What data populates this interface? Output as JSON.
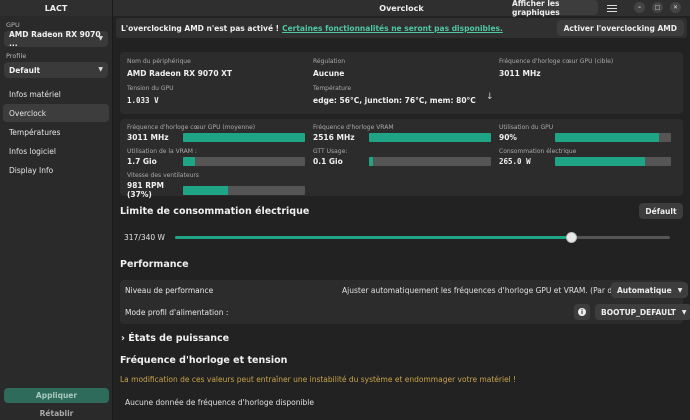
{
  "sidebar": {
    "app_title": "LACT",
    "gpu_label": "GPU",
    "gpu_value": "AMD Radeon RX 9070 ...",
    "profile_label": "Profile",
    "profile_value": "Default",
    "items": [
      {
        "label": "Infos matériel"
      },
      {
        "label": "Overclock"
      },
      {
        "label": "Températures"
      },
      {
        "label": "Infos logiciel"
      },
      {
        "label": "Display Info"
      }
    ],
    "apply_label": "Appliquer",
    "reset_label": "Rétablir"
  },
  "topbar": {
    "title": "Overclock",
    "graphs_button": "Afficher les graphiques",
    "minimize": "–",
    "maximize": "□",
    "close": "✕"
  },
  "banner": {
    "text": "L'overclocking AMD n'est pas activé !",
    "link": "Certaines fonctionnalités ne seront pas disponibles.",
    "button": "Activer l'overclocking AMD"
  },
  "info": {
    "device_name_label": "Nom du périphérique",
    "device_name": "AMD Radeon RX 9070 XT",
    "regulation_label": "Régulation",
    "regulation": "Aucune",
    "target_clock_label": "Fréquence d'horloge cœur GPU (cible)",
    "target_clock": "3011 MHz",
    "voltage_label": "Tension du GPU",
    "voltage": "1.033 V",
    "temperature_label": "Température",
    "temperature": "edge: 56°C, junction: 76°C, mem: 80°C"
  },
  "stats": {
    "core_clock_label": "Fréquence d'horloge cœur GPU (moyenne)",
    "core_clock": "3011 MHz",
    "core_clock_fill": 1.0,
    "vram_clock_label": "Fréquence d'horloge VRAM",
    "vram_clock": "2516 MHz",
    "vram_clock_fill": 1.0,
    "gpu_usage_label": "Utilisation du GPU",
    "gpu_usage": "90%",
    "gpu_usage_fill": 0.9,
    "vram_usage_label": "Utilisation de la VRAM :",
    "vram_usage": "1.7 Gio",
    "vram_usage_fill": 0.1,
    "gtt_label": "GTT Usage:",
    "gtt": "0.1 Gio",
    "gtt_fill": 0.03,
    "power_label": "Consommation électrique",
    "power": "265.0 W",
    "power_fill": 0.78,
    "fan_label": "Vitesse des ventilateurs",
    "fan": "981 RPM (37%)",
    "fan_fill": 0.37
  },
  "power_limit": {
    "title": "Limite de consommation électrique",
    "default_button": "Défault",
    "value_label": "317/340 W",
    "fraction": 0.8
  },
  "performance": {
    "title": "Performance",
    "level_label": "Niveau de performance",
    "level_desc": "Ajuster automatiquement les fréquences d'horloge GPU et VRAM. (Par défaut)",
    "level_value": "Automatique",
    "profile_label": "Mode profil d'alimentation :",
    "profile_value": "BOOTUP_DEFAULT"
  },
  "power_states": {
    "title": "États de puissance"
  },
  "clock_voltage": {
    "title": "Fréquence d'horloge et tension",
    "warning": "La modification de ces valeurs peut entraîner une instabilité du système et endommager votre matériel !",
    "no_data": "Aucune donnée de fréquence d'horloge disponible"
  },
  "colors": {
    "accent": "#1fa586",
    "link": "#4fc7a5",
    "warning": "#c9a24a"
  }
}
